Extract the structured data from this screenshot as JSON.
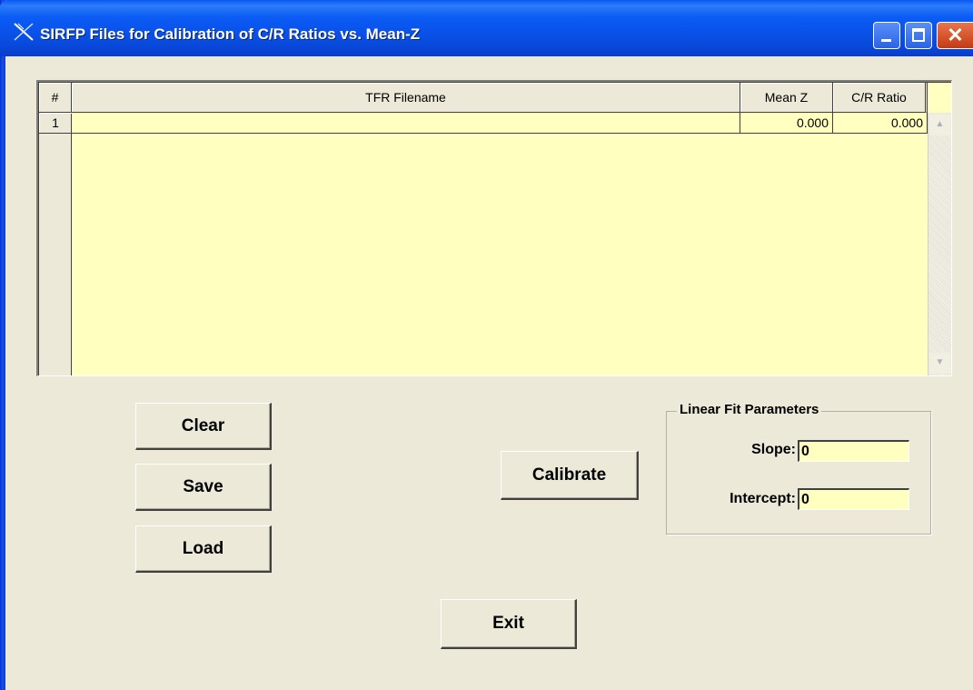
{
  "window": {
    "title": "SIRFP Files for Calibration of C/R Ratios vs. Mean-Z",
    "close_glyph": "✕"
  },
  "table": {
    "columns": [
      "#",
      "TFR Filename",
      "Mean Z",
      "C/R Ratio"
    ],
    "rows": [
      {
        "num": "1",
        "filename": "",
        "mean_z": "0.000",
        "cr_ratio": "0.000"
      }
    ]
  },
  "buttons": {
    "clear": "Clear",
    "save": "Save",
    "load": "Load",
    "calibrate": "Calibrate",
    "exit": "Exit"
  },
  "fit": {
    "legend": "Linear Fit Parameters",
    "slope_label": "Slope:",
    "slope_value": "0",
    "intercept_label": "Intercept:",
    "intercept_value": "0"
  },
  "colors": {
    "grid_bg": "#ffffc0",
    "title_bar": "#0a51e9",
    "face": "#ece9d8"
  }
}
